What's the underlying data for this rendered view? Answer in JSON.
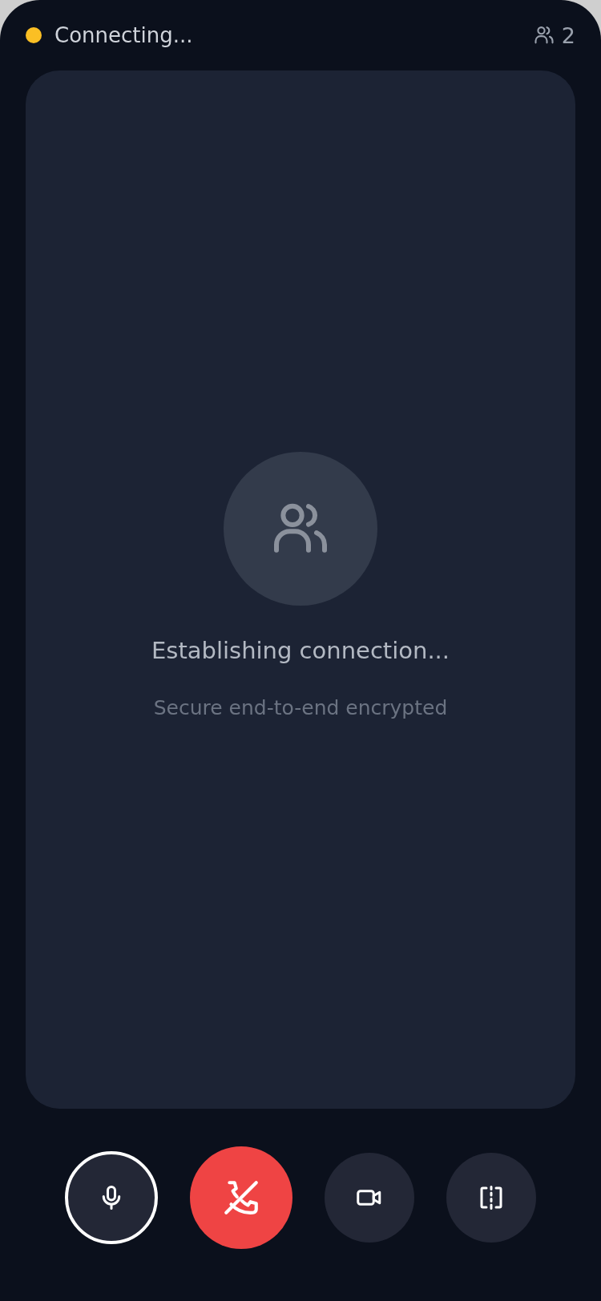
{
  "status": {
    "label": "Connecting...",
    "color": "#fbbf24"
  },
  "participants": {
    "count": "2"
  },
  "stage": {
    "title": "Establishing connection...",
    "subtitle": "Secure end-to-end encrypted"
  },
  "controls": [
    {
      "kind": "mic",
      "selected": true
    },
    {
      "kind": "hangup",
      "selected": false
    },
    {
      "kind": "camera",
      "selected": false
    },
    {
      "kind": "layout",
      "selected": false
    }
  ]
}
